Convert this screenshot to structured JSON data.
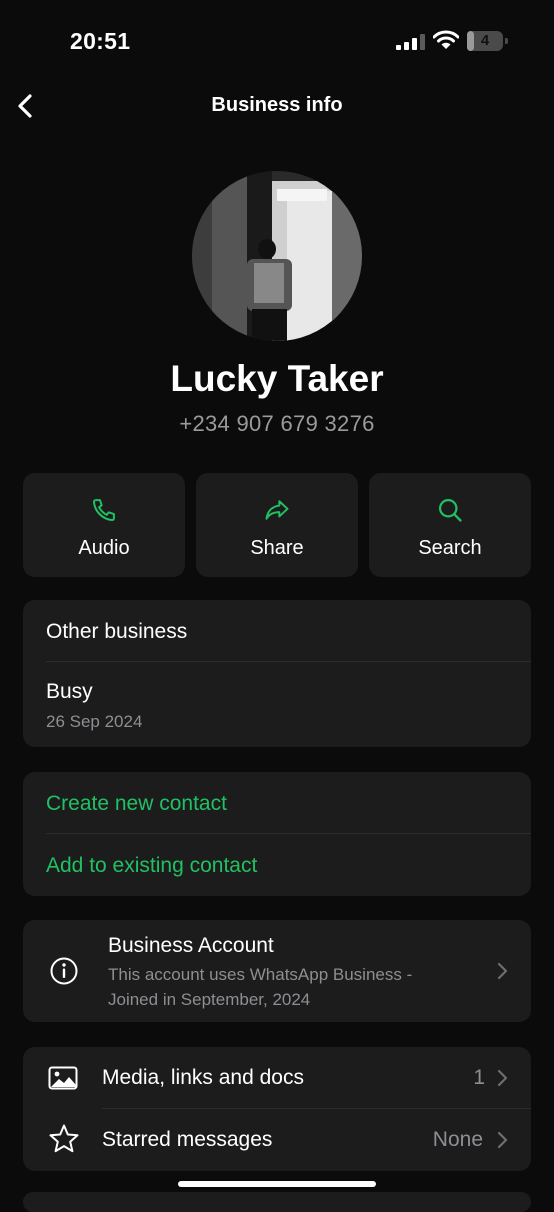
{
  "status_bar": {
    "time": "20:51",
    "battery": "4",
    "battery_fraction": 0.2
  },
  "nav": {
    "title": "Business info"
  },
  "profile": {
    "name": "Lucky Taker",
    "phone": "+234 907 679 3276"
  },
  "actions": [
    {
      "label": "Audio",
      "icon": "phone-icon"
    },
    {
      "label": "Share",
      "icon": "share-arrow-icon"
    },
    {
      "label": "Search",
      "icon": "search-icon"
    }
  ],
  "about": {
    "category": "Other business",
    "status": "Busy",
    "status_date": "26 Sep 2024"
  },
  "contact_actions": {
    "create": "Create new contact",
    "add_existing": "Add to existing contact"
  },
  "business_account": {
    "title": "Business Account",
    "description_line1": "This account uses WhatsApp Business -",
    "description_line2": "Joined in September, 2024"
  },
  "media": {
    "media_label": "Media, links and docs",
    "media_count": "1",
    "starred_label": "Starred messages",
    "starred_value": "None"
  },
  "colors": {
    "accent": "#21c063",
    "background": "#0b0b0b",
    "card": "#1c1c1c",
    "secondary_text": "#8e8e93"
  }
}
